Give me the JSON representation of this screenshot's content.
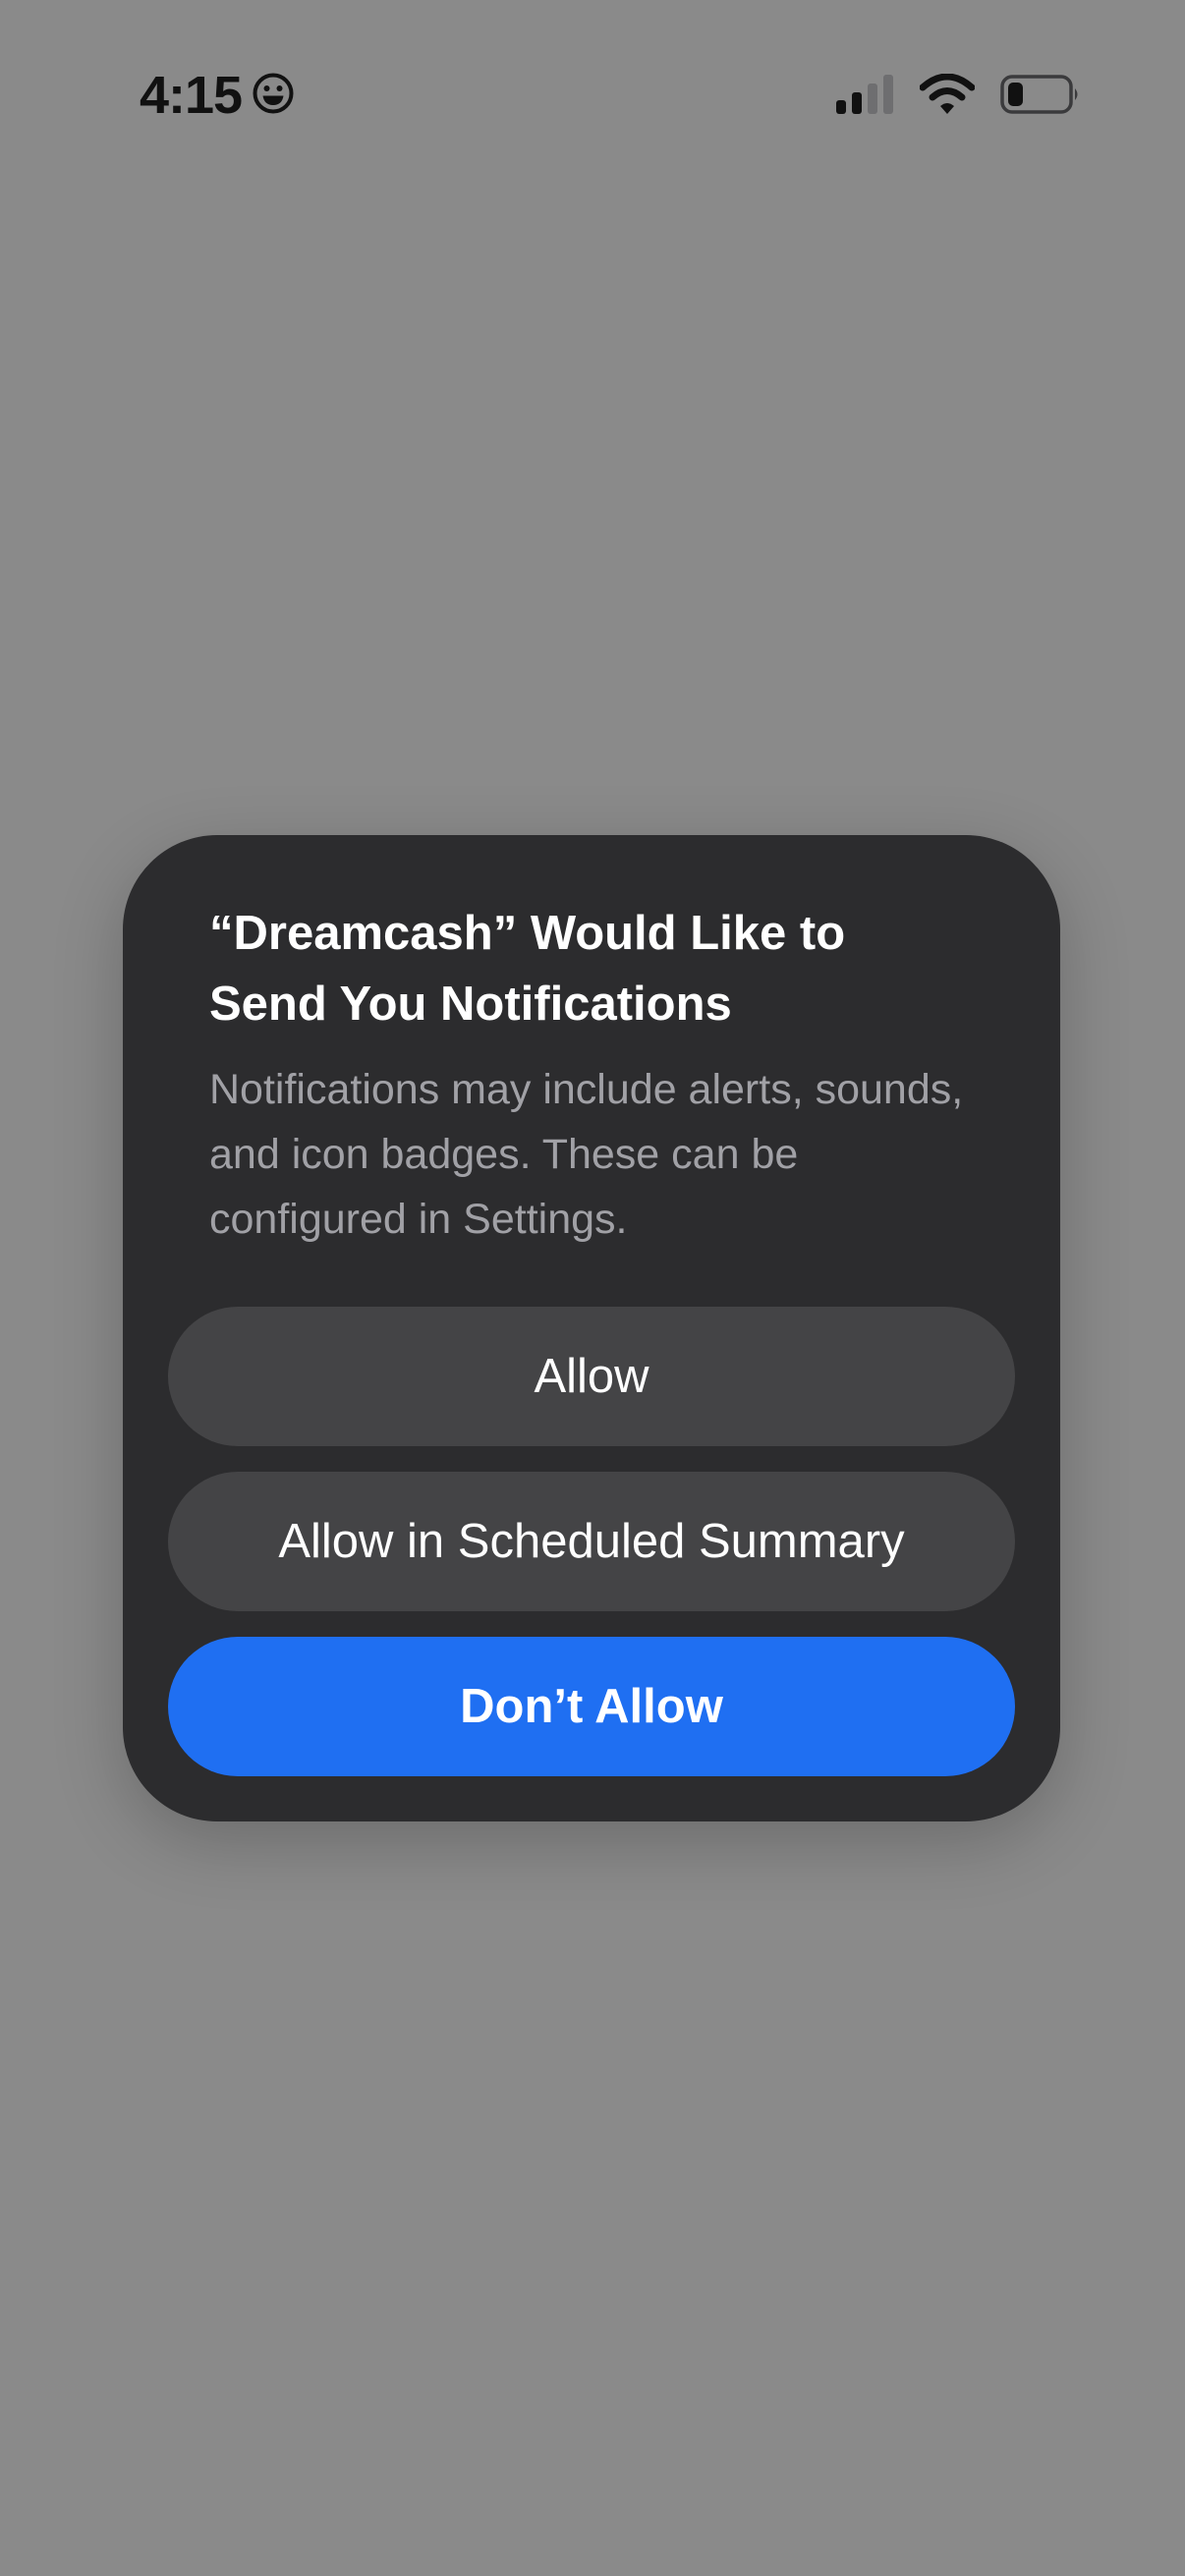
{
  "status_bar": {
    "time": "4:15",
    "time_emoji_icon": "smiley-icon",
    "signal_icon": "cellular-signal-icon",
    "wifi_icon": "wifi-icon",
    "battery_icon": "battery-low-icon"
  },
  "alert": {
    "title": "“Dreamcash” Would Like to Send You Notifications",
    "message": "Notifications may include alerts, sounds, and icon badges. These can be configured in Settings.",
    "buttons": {
      "allow": "Allow",
      "scheduled_summary": "Allow in Scheduled Summary",
      "dont_allow": "Don’t Allow"
    }
  },
  "colors": {
    "dimmed_background": "#8a8a8a",
    "alert_background": "#2c2c2e",
    "secondary_button": "#444446",
    "primary_button": "#1f6ff2"
  }
}
